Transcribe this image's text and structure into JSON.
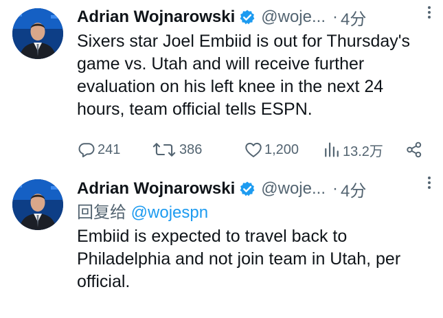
{
  "tweets": [
    {
      "author": "Adrian Wojnarowski",
      "handle": "@woje...",
      "separator": "·",
      "time": "4分",
      "text": "Sixers star Joel Embiid is out for Thursday's game vs. Utah and will receive further evaluation on his left knee in the next 24 hours, team official tells ESPN.",
      "stats": {
        "replies": "241",
        "retweets": "386",
        "likes": "1,200",
        "views": "13.2万"
      }
    },
    {
      "author": "Adrian Wojnarowski",
      "handle": "@woje...",
      "separator": "·",
      "time": "4分",
      "reply_prefix": "回复给",
      "reply_handle": "@wojespn",
      "text": "Embiid is expected to travel back to Philadelphia and not join team in Utah, per official."
    }
  ],
  "icons": {
    "verified": "verified-badge-icon",
    "more": "more-dots-icon",
    "reply": "reply-bubble-icon",
    "retweet": "retweet-icon",
    "like": "heart-icon",
    "views": "bar-chart-icon",
    "share": "share-icon"
  },
  "colors": {
    "verified": "#1d9bf0",
    "link": "#1d9bf0",
    "muted": "#536471",
    "text": "#0f1419"
  }
}
